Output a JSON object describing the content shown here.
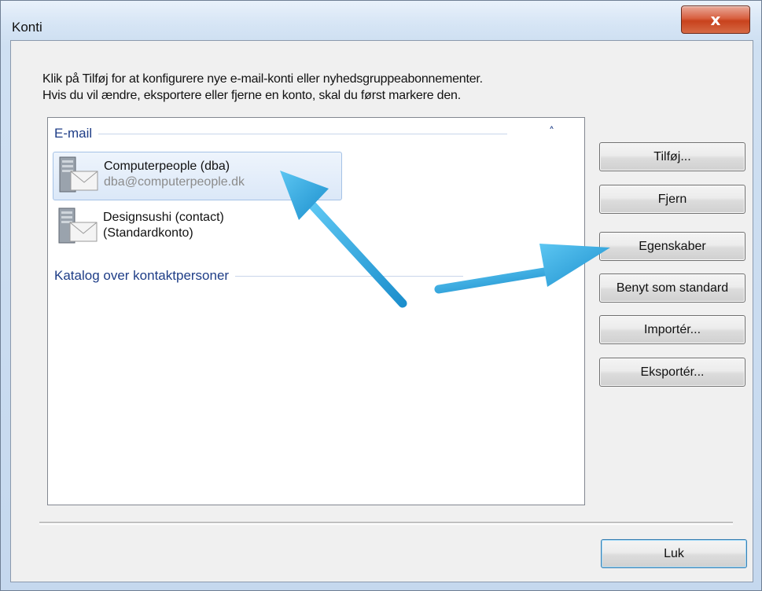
{
  "window": {
    "title": "Konti",
    "close_label": "x"
  },
  "instructions": {
    "line1": "Klik på Tilføj for at konfigurere nye e-mail-konti eller nyhedsgruppeabonnementer.",
    "line2": "Hvis du vil ændre, eksportere eller fjerne en konto, skal du først markere den."
  },
  "list": {
    "groups": [
      {
        "label": "E-mail",
        "collapse_icon": "chevron-up-icon"
      },
      {
        "label": "Katalog over kontaktpersoner"
      }
    ],
    "accounts": [
      {
        "name": "Computerpeople (dba)",
        "detail": "dba@computerpeople.dk",
        "selected": true,
        "icon": "mail-server-icon"
      },
      {
        "name": "Designsushi (contact)",
        "detail": "(Standardkonto)",
        "selected": false,
        "icon": "mail-server-icon"
      }
    ]
  },
  "buttons": {
    "add": "Tilføj...",
    "remove": "Fjern",
    "properties": "Egenskaber",
    "set_default": "Benyt som standard",
    "import": "Importér...",
    "export": "Eksportér...",
    "close": "Luk"
  },
  "annotation": {
    "arrow_color": "#2aa7e0",
    "arrows": [
      "arrow-to-account",
      "arrow-to-properties"
    ]
  }
}
